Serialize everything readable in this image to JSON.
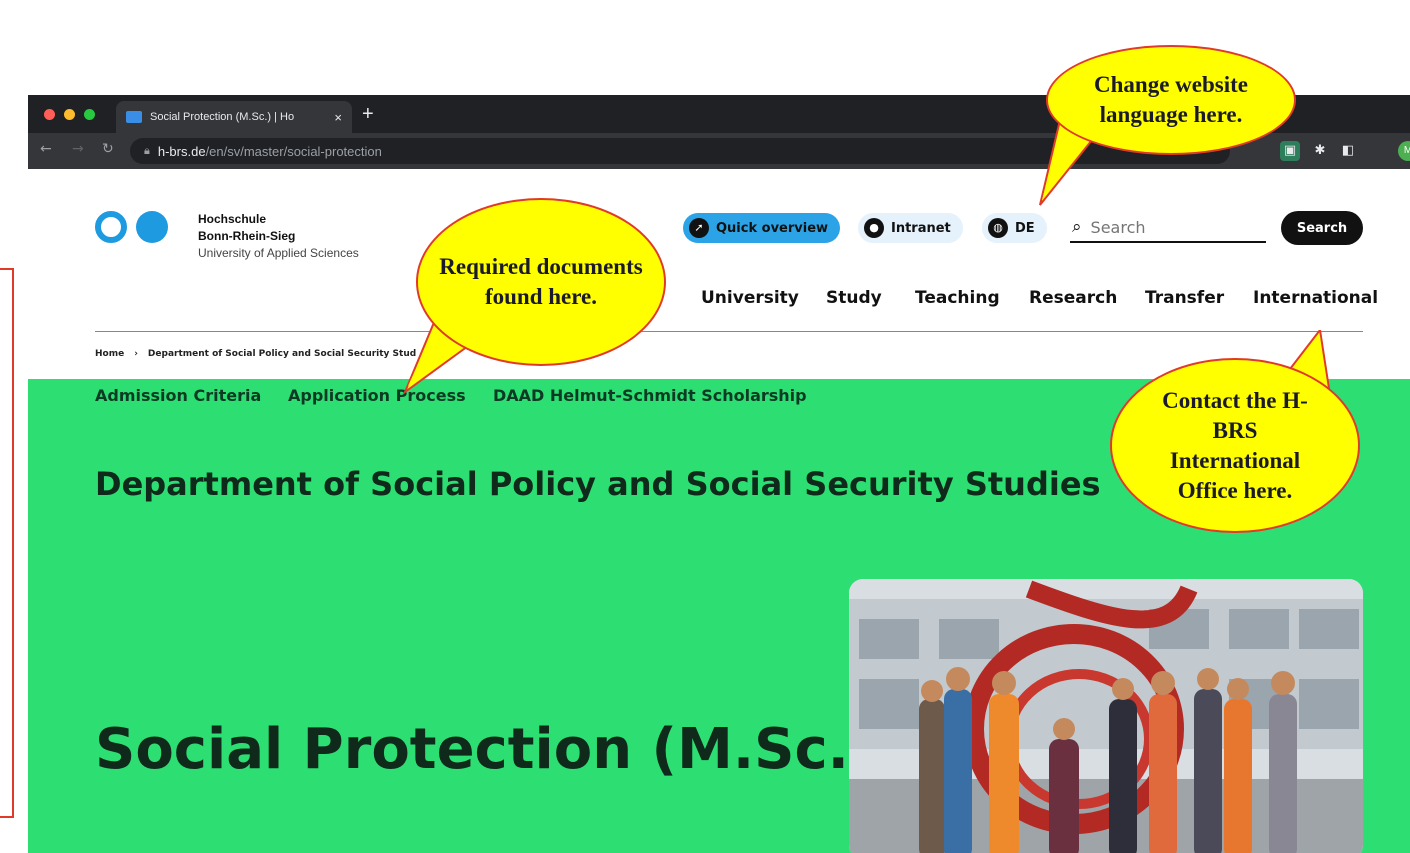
{
  "browser": {
    "tab_title": "Social Protection (M.Sc.) | Ho",
    "tab_close": "×",
    "new_tab": "+",
    "url_host": "h-brs.de",
    "url_path": "/en/sv/master/social-protection",
    "profile_initial": "M"
  },
  "header": {
    "logo_line1": "Hochschule",
    "logo_line2": "Bonn-Rhein-Sieg",
    "logo_line3": "University of Applied Sciences",
    "quick_overview": "Quick overview",
    "intranet": "Intranet",
    "language": "DE",
    "search_placeholder": "Search",
    "search_button": "Search"
  },
  "main_nav": [
    "University",
    "Study",
    "Teaching",
    "Research",
    "Transfer",
    "International"
  ],
  "breadcrumb": {
    "home": "Home",
    "separator": "›",
    "current": "Department of Social Policy and Social Security Stud"
  },
  "subnav": [
    "Admission Criteria",
    "Application Process",
    "DAAD Helmut-Schmidt Scholarship"
  ],
  "hero": {
    "department": "Department of Social Policy and Social Security Studies",
    "program": "Social Protection (M.Sc.)"
  },
  "callouts": {
    "language": "Change website language here.",
    "documents": "Required documents found here.",
    "international": "Contact the H-BRS International Office here."
  },
  "colors": {
    "hero_green": "#2ddf73",
    "brand_blue": "#1e9ae0",
    "callout_fill": "#ffff00",
    "callout_border": "#e03a2a"
  }
}
